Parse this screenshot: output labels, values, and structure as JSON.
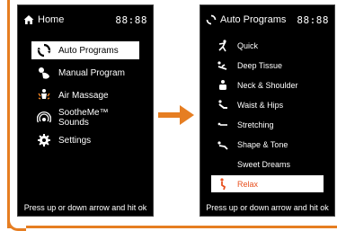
{
  "accent": "#e67e22",
  "home_screen": {
    "title": "Home",
    "time": "88:88",
    "menu": [
      {
        "label": "Auto Programs",
        "icon": "circular-arrows-icon",
        "selected": true
      },
      {
        "label": "Manual Program",
        "icon": "hand-pointer-icon",
        "selected": false
      },
      {
        "label": "Air Massage",
        "icon": "person-air-icon",
        "selected": false
      },
      {
        "label": "SootheMe™ Sounds",
        "icon": "sound-waves-icon",
        "selected": false
      },
      {
        "label": "Settings",
        "icon": "gear-icon",
        "selected": false
      }
    ],
    "footer": "Press up or down arrow and hit ok"
  },
  "programs_screen": {
    "title": "Auto Programs",
    "time": "88:88",
    "menu": [
      {
        "label": "Quick",
        "icon": "running-person-icon",
        "selected": false
      },
      {
        "label": "Deep Tissue",
        "icon": "reclining-person-icon",
        "selected": false
      },
      {
        "label": "Neck & Shoulder",
        "icon": "neck-shoulder-icon",
        "selected": false
      },
      {
        "label": "Waist & Hips",
        "icon": "waist-hips-icon",
        "selected": false
      },
      {
        "label": "Stretching",
        "icon": "stretching-icon",
        "selected": false
      },
      {
        "label": "Shape & Tone",
        "icon": "shape-tone-icon",
        "selected": false
      },
      {
        "label": "Sweet Dreams",
        "icon": "moon-icon",
        "selected": false
      },
      {
        "label": "Relax",
        "icon": "relax-person-icon",
        "selected": true
      }
    ],
    "footer": "Press up or down arrow and hit ok"
  },
  "transition_arrow_icon": "right-arrow-icon"
}
